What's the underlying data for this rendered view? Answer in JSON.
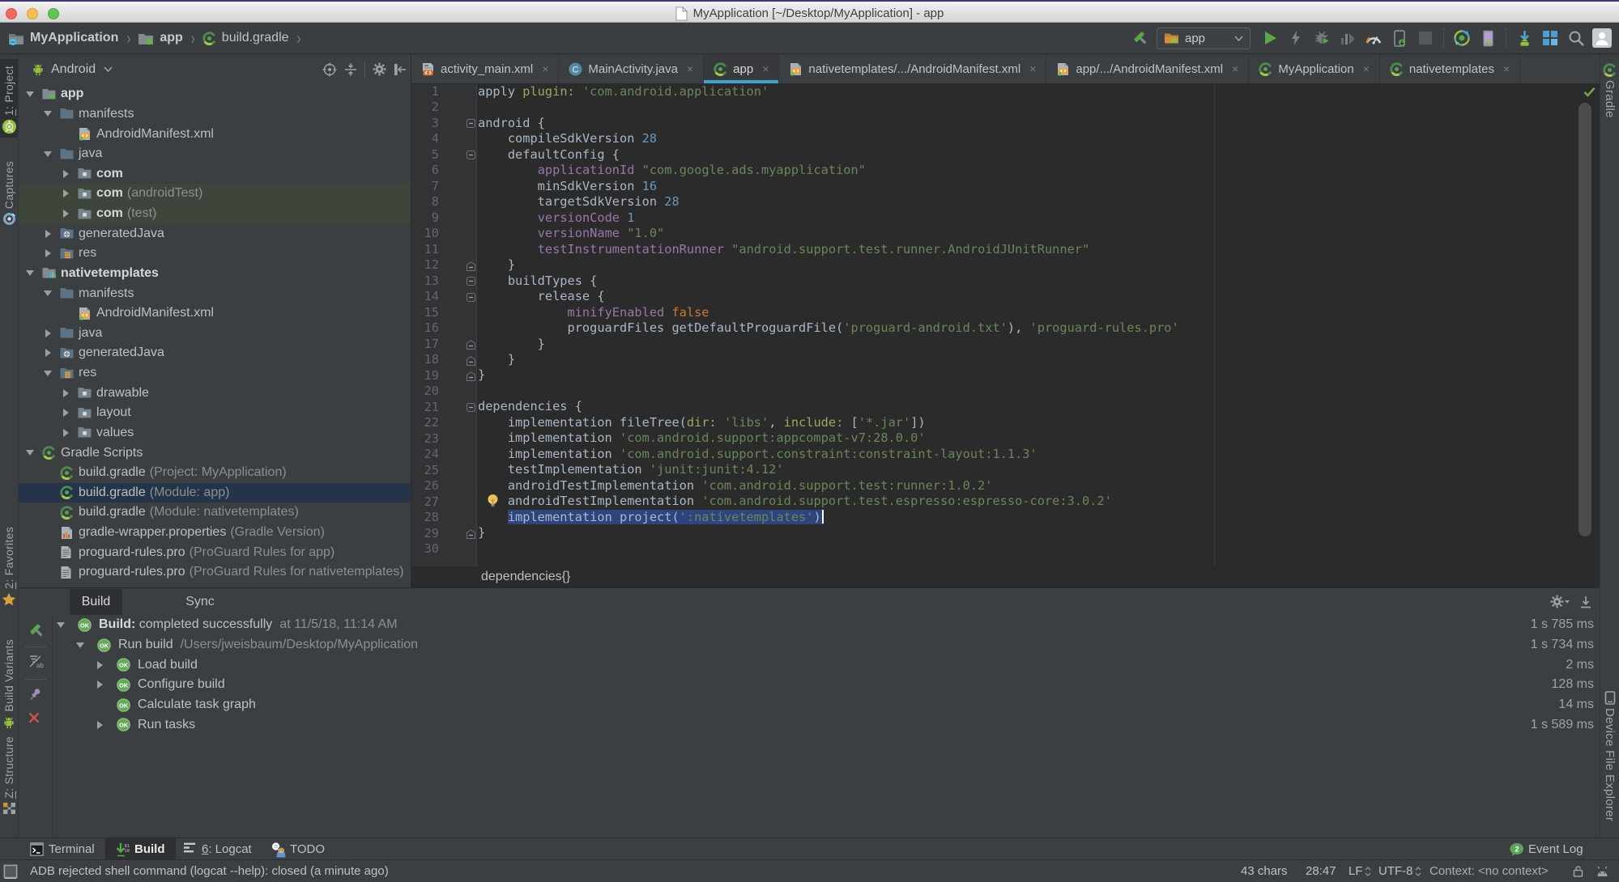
{
  "colors": {
    "panel_bg": "#3C3F41",
    "editor_bg": "#2B2B2B",
    "accent_tab_underline": "#3DA3CC",
    "editor_selection": "#2D447D",
    "tree_selection": "#253449",
    "test_scope_row": "#3E463B",
    "syntax": {
      "default": "#A9B7C6",
      "string": "#6A8759",
      "number": "#6897BB",
      "keyword": "#CC7832",
      "property": "#9876AA",
      "named_arg": "#9EA65B"
    },
    "traffic_lights": [
      "#EE6A5E",
      "#F5BE4F",
      "#61C454"
    ]
  },
  "title_bar": {
    "title": "MyApplication [~/Desktop/MyApplication] - app",
    "icon": "document-icon"
  },
  "navbar": {
    "items": [
      {
        "label": "MyApplication",
        "icon": "project-folder-icon",
        "bold": true
      },
      {
        "label": "app",
        "icon": "module-folder-icon",
        "bold": true
      },
      {
        "label": "build.gradle",
        "icon": "gradle-icon",
        "bold": false
      }
    ]
  },
  "toolbar": {
    "run_config": {
      "label": "app",
      "icon": "run-config-folder-icon"
    },
    "buttons": [
      {
        "name": "build-hammer-button",
        "icon": "hammer-icon"
      },
      {
        "name": "run-button",
        "icon": "run-play-icon"
      },
      {
        "name": "apply-changes-button",
        "icon": "lightning-icon"
      },
      {
        "name": "debug-button",
        "icon": "debug-bug-icon"
      },
      {
        "name": "profile-button",
        "icon": "profile-bars-icon"
      },
      {
        "name": "profiler-button",
        "icon": "gauge-icon"
      },
      {
        "name": "attach-debugger-button",
        "icon": "phone-attach-icon"
      },
      {
        "name": "stop-button",
        "icon": "stop-square-icon"
      },
      {
        "name": "sync-gradle-button",
        "icon": "gradle-sync-icon"
      },
      {
        "name": "avd-manager-button",
        "icon": "avd-phone-icon"
      },
      {
        "name": "sdk-manager-button",
        "icon": "sdk-download-icon"
      },
      {
        "name": "project-structure-button",
        "icon": "structure-squares-icon"
      },
      {
        "name": "search-everywhere-button",
        "icon": "search-icon"
      },
      {
        "name": "profile-avatar",
        "icon": "avatar-icon"
      }
    ]
  },
  "left_stripe": {
    "top": [
      {
        "label": "1: Project",
        "icon": "android-studio-icon",
        "active": true,
        "mnemonic": "1"
      },
      {
        "label": "Captures",
        "icon": "captures-icon",
        "active": false
      }
    ],
    "bottom": [
      {
        "label": "2: Favorites",
        "icon": "star-icon",
        "mnemonic": "2"
      },
      {
        "label": "Build Variants",
        "icon": "android-robot-icon"
      },
      {
        "label": "Z: Structure",
        "icon": "structure-tool-icon",
        "mnemonic": "Z"
      }
    ]
  },
  "right_stripe": {
    "items": [
      {
        "label": "Gradle",
        "icon": "gradle-icon"
      },
      {
        "label": "Device File Explorer",
        "icon": "device-phone-icon"
      }
    ]
  },
  "project_panel": {
    "view_selector": "Android",
    "header_icons": [
      "locate-icon",
      "collapse-all-icon",
      "gear-icon",
      "hide-panel-icon"
    ],
    "tree": [
      {
        "label": "app",
        "level": 0,
        "icon": "module-app-folder-icon",
        "arrow": "down",
        "bold": true
      },
      {
        "label": "manifests",
        "level": 1,
        "icon": "folder-icon",
        "arrow": "down"
      },
      {
        "label": "AndroidManifest.xml",
        "level": 2,
        "icon": "manifest-file-icon"
      },
      {
        "label": "java",
        "level": 1,
        "icon": "folder-icon",
        "arrow": "down"
      },
      {
        "label": "com",
        "level": 2,
        "icon": "package-folder-icon",
        "arrow": "right",
        "bold": true
      },
      {
        "label": "com",
        "dim": "(androidTest)",
        "level": 2,
        "icon": "package-folder-icon",
        "arrow": "right",
        "bold": true,
        "scope": "test"
      },
      {
        "label": "com",
        "dim": "(test)",
        "level": 2,
        "icon": "package-folder-icon",
        "arrow": "right",
        "bold": true,
        "scope": "test"
      },
      {
        "label": "generatedJava",
        "level": 1,
        "icon": "generated-folder-icon",
        "arrow": "right"
      },
      {
        "label": "res",
        "level": 1,
        "icon": "res-folder-icon",
        "arrow": "right"
      },
      {
        "label": "nativetemplates",
        "level": 0,
        "icon": "module-lib-folder-icon",
        "arrow": "down",
        "bold": true
      },
      {
        "label": "manifests",
        "level": 1,
        "icon": "folder-icon",
        "arrow": "down"
      },
      {
        "label": "AndroidManifest.xml",
        "level": 2,
        "icon": "manifest-file-icon"
      },
      {
        "label": "java",
        "level": 1,
        "icon": "folder-icon",
        "arrow": "right"
      },
      {
        "label": "generatedJava",
        "level": 1,
        "icon": "generated-folder-icon",
        "arrow": "right"
      },
      {
        "label": "res",
        "level": 1,
        "icon": "res-folder-icon",
        "arrow": "down"
      },
      {
        "label": "drawable",
        "level": 2,
        "icon": "package-folder-icon",
        "arrow": "right"
      },
      {
        "label": "layout",
        "level": 2,
        "icon": "package-folder-icon",
        "arrow": "right"
      },
      {
        "label": "values",
        "level": 2,
        "icon": "package-folder-icon",
        "arrow": "right"
      },
      {
        "label": "Gradle Scripts",
        "level": 0,
        "icon": "gradle-icon",
        "arrow": "down"
      },
      {
        "label": "build.gradle",
        "dim": "(Project: MyApplication)",
        "level": 1,
        "icon": "gradle-icon"
      },
      {
        "label": "build.gradle",
        "dim": "(Module: app)",
        "level": 1,
        "icon": "gradle-icon",
        "selected": true
      },
      {
        "label": "build.gradle",
        "dim": "(Module: nativetemplates)",
        "level": 1,
        "icon": "gradle-icon"
      },
      {
        "label": "gradle-wrapper.properties",
        "dim": "(Gradle Version)",
        "level": 1,
        "icon": "wrapper-file-icon"
      },
      {
        "label": "proguard-rules.pro",
        "dim": "(ProGuard Rules for app)",
        "level": 1,
        "icon": "text-file-icon"
      },
      {
        "label": "proguard-rules.pro",
        "dim": "(ProGuard Rules for nativetemplates)",
        "level": 1,
        "icon": "text-file-icon"
      }
    ]
  },
  "editor": {
    "tabs": [
      {
        "label": "activity_main.xml",
        "icon": "layout-xml-file-icon"
      },
      {
        "label": "MainActivity.java",
        "icon": "java-class-icon"
      },
      {
        "label": "app",
        "icon": "gradle-icon",
        "active": true
      },
      {
        "label": "nativetemplates/.../AndroidManifest.xml",
        "icon": "manifest-file-icon"
      },
      {
        "label": "app/.../AndroidManifest.xml",
        "icon": "manifest-file-icon"
      },
      {
        "label": "MyApplication",
        "icon": "gradle-icon"
      },
      {
        "label": "nativetemplates",
        "icon": "gradle-icon"
      }
    ],
    "breadcrumb": "dependencies{}",
    "line_count": 30,
    "folds": {
      "3": "open",
      "5": "open",
      "12": "close",
      "13": "open",
      "14": "open",
      "17": "close",
      "18": "close",
      "19": "close",
      "21": "open",
      "29": "close"
    },
    "lightbulb_line": 27,
    "code_lines": [
      {
        "n": 1,
        "tokens": [
          [
            "apply ",
            "d"
          ],
          [
            "plugin:",
            "na"
          ],
          [
            " ",
            "d"
          ],
          [
            "'com.android.application'",
            "s"
          ]
        ]
      },
      {
        "n": 2,
        "tokens": []
      },
      {
        "n": 3,
        "tokens": [
          [
            "android {",
            "d"
          ]
        ]
      },
      {
        "n": 4,
        "tokens": [
          [
            "    compileSdkVersion ",
            "d"
          ],
          [
            "28",
            "n"
          ]
        ]
      },
      {
        "n": 5,
        "tokens": [
          [
            "    defaultConfig {",
            "d"
          ]
        ]
      },
      {
        "n": 6,
        "tokens": [
          [
            "        ",
            "d"
          ],
          [
            "applicationId",
            "p"
          ],
          [
            " ",
            "d"
          ],
          [
            "\"com.google.ads.myapplication\"",
            "s"
          ]
        ]
      },
      {
        "n": 7,
        "tokens": [
          [
            "        minSdkVersion ",
            "d"
          ],
          [
            "16",
            "n"
          ]
        ]
      },
      {
        "n": 8,
        "tokens": [
          [
            "        targetSdkVersion ",
            "d"
          ],
          [
            "28",
            "n"
          ]
        ]
      },
      {
        "n": 9,
        "tokens": [
          [
            "        ",
            "d"
          ],
          [
            "versionCode",
            "p"
          ],
          [
            " ",
            "d"
          ],
          [
            "1",
            "n"
          ]
        ]
      },
      {
        "n": 10,
        "tokens": [
          [
            "        ",
            "d"
          ],
          [
            "versionName",
            "p"
          ],
          [
            " ",
            "d"
          ],
          [
            "\"1.0\"",
            "s"
          ]
        ]
      },
      {
        "n": 11,
        "tokens": [
          [
            "        ",
            "d"
          ],
          [
            "testInstrumentationRunner",
            "p"
          ],
          [
            " ",
            "d"
          ],
          [
            "\"android.support.test.runner.AndroidJUnitRunner\"",
            "s"
          ]
        ]
      },
      {
        "n": 12,
        "tokens": [
          [
            "    }",
            "d"
          ]
        ]
      },
      {
        "n": 13,
        "tokens": [
          [
            "    buildTypes {",
            "d"
          ]
        ]
      },
      {
        "n": 14,
        "tokens": [
          [
            "        release {",
            "d"
          ]
        ]
      },
      {
        "n": 15,
        "tokens": [
          [
            "            ",
            "d"
          ],
          [
            "minifyEnabled",
            "p"
          ],
          [
            " ",
            "d"
          ],
          [
            "false",
            "k"
          ]
        ]
      },
      {
        "n": 16,
        "tokens": [
          [
            "            proguardFiles getDefaultProguardFile(",
            "d"
          ],
          [
            "'proguard-android.txt'",
            "s"
          ],
          [
            "), ",
            "d"
          ],
          [
            "'proguard-rules.pro'",
            "s"
          ]
        ]
      },
      {
        "n": 17,
        "tokens": [
          [
            "        }",
            "d"
          ]
        ]
      },
      {
        "n": 18,
        "tokens": [
          [
            "    }",
            "d"
          ]
        ]
      },
      {
        "n": 19,
        "tokens": [
          [
            "}",
            "d"
          ]
        ]
      },
      {
        "n": 20,
        "tokens": []
      },
      {
        "n": 21,
        "tokens": [
          [
            "dependencies {",
            "d"
          ]
        ]
      },
      {
        "n": 22,
        "tokens": [
          [
            "    implementation fileTree(",
            "d"
          ],
          [
            "dir:",
            "na"
          ],
          [
            " ",
            "d"
          ],
          [
            "'libs'",
            "s"
          ],
          [
            ", ",
            "d"
          ],
          [
            "include:",
            "na"
          ],
          [
            " [",
            "d"
          ],
          [
            "'*.jar'",
            "s"
          ],
          [
            "])",
            "d"
          ]
        ]
      },
      {
        "n": 23,
        "tokens": [
          [
            "    implementation ",
            "d"
          ],
          [
            "'com.android.support:appcompat-v7:28.0.0'",
            "s"
          ]
        ]
      },
      {
        "n": 24,
        "tokens": [
          [
            "    implementation ",
            "d"
          ],
          [
            "'com.android.support.constraint:constraint-layout:1.1.3'",
            "s"
          ]
        ]
      },
      {
        "n": 25,
        "tokens": [
          [
            "    testImplementation ",
            "d"
          ],
          [
            "'junit:junit:4.12'",
            "s"
          ]
        ]
      },
      {
        "n": 26,
        "tokens": [
          [
            "    androidTestImplementation ",
            "d"
          ],
          [
            "'com.android.support.test:runner:1.0.2'",
            "s"
          ]
        ]
      },
      {
        "n": 27,
        "tokens": [
          [
            "    androidTestImplementation ",
            "d"
          ],
          [
            "'com.android.support.test.espresso:espresso-core:3.0.2'",
            "s"
          ]
        ]
      },
      {
        "n": 28,
        "sel_from": 4,
        "caret": true,
        "tokens": [
          [
            "    ",
            "d"
          ],
          [
            "implementation project(",
            "d"
          ],
          [
            "':nativetemplates'",
            "s"
          ],
          [
            ")",
            "d"
          ]
        ]
      },
      {
        "n": 29,
        "tokens": [
          [
            "}",
            "d"
          ]
        ]
      },
      {
        "n": 30,
        "tokens": []
      }
    ]
  },
  "build_panel": {
    "tabs": [
      {
        "label": "Build",
        "active": true
      },
      {
        "label": "Sync",
        "active": false
      }
    ],
    "header_icons": [
      "gear-icon",
      "import-icon"
    ],
    "toolbar_icons": [
      "hammer-icon",
      "filter-icon",
      "pin-icon",
      "close-red-icon"
    ],
    "rows": [
      {
        "level": 0,
        "arrow": "down",
        "ok": true,
        "bold": "Build:",
        "label": " completed successfully",
        "detail": "at 11/5/18, 11:14 AM",
        "time": "1 s 785 ms"
      },
      {
        "level": 1,
        "arrow": "down",
        "ok": true,
        "label": "Run build",
        "detail": "/Users/jweisbaum/Desktop/MyApplication",
        "time": "1 s 734 ms"
      },
      {
        "level": 2,
        "arrow": "right",
        "ok": true,
        "label": "Load build",
        "time": "2 ms"
      },
      {
        "level": 2,
        "arrow": "right",
        "ok": true,
        "label": "Configure build",
        "time": "128 ms"
      },
      {
        "level": 2,
        "arrow": null,
        "ok": true,
        "label": "Calculate task graph",
        "time": "14 ms"
      },
      {
        "level": 2,
        "arrow": "right",
        "ok": true,
        "label": "Run tasks",
        "time": "1 s 589 ms"
      }
    ]
  },
  "bottom_bar": {
    "items": [
      {
        "label": "Terminal",
        "icon": "terminal-icon"
      },
      {
        "label": "Build",
        "icon": "build-arrow-icon",
        "active": true
      },
      {
        "label": "6: Logcat",
        "icon": "logcat-lines-icon",
        "mnemonic": "6"
      },
      {
        "label": "TODO",
        "icon": "todo-person-icon"
      }
    ],
    "event_log": {
      "label": "Event Log",
      "badge": "2",
      "icon": "event-bubble-icon"
    }
  },
  "status_bar": {
    "message": "ADB rejected shell command (logcat --help): closed (a minute ago)",
    "chars": "43 chars",
    "position": "28:47",
    "line_ending": "LF",
    "encoding": "UTF-8",
    "context": "Context: <no context>",
    "icons": [
      "toggle-stripes-icon",
      "lock-icon",
      "android-head-icon"
    ]
  }
}
